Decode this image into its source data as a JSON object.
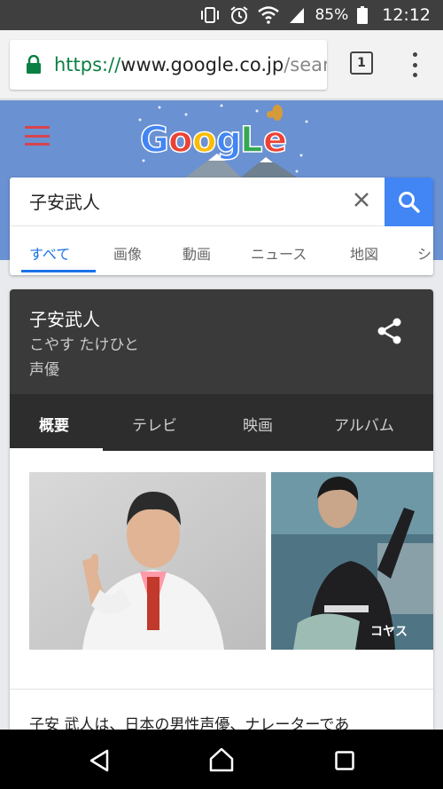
{
  "status_bar": {
    "battery": "85%",
    "time": "12:12"
  },
  "browser": {
    "url_scheme": "https://",
    "url_domain": "www.google.co.jp",
    "url_path": "/sear",
    "tab_count": "1"
  },
  "search": {
    "query": "子安武人",
    "tabs": [
      "すべて",
      "画像",
      "動画",
      "ニュース",
      "地図",
      "シ"
    ]
  },
  "knowledge_panel": {
    "title": "子安武人",
    "reading": "こやす たけひと",
    "occupation": "声優",
    "tabs": [
      "概要",
      "テレビ",
      "映画",
      "アルバム"
    ],
    "description": "子安 武人は、日本の男性声優、ナレーターであ"
  },
  "colors": {
    "accent": "#4285f4",
    "header_bg": "#6a91d2",
    "panel_dark": "#3a3a3a"
  }
}
